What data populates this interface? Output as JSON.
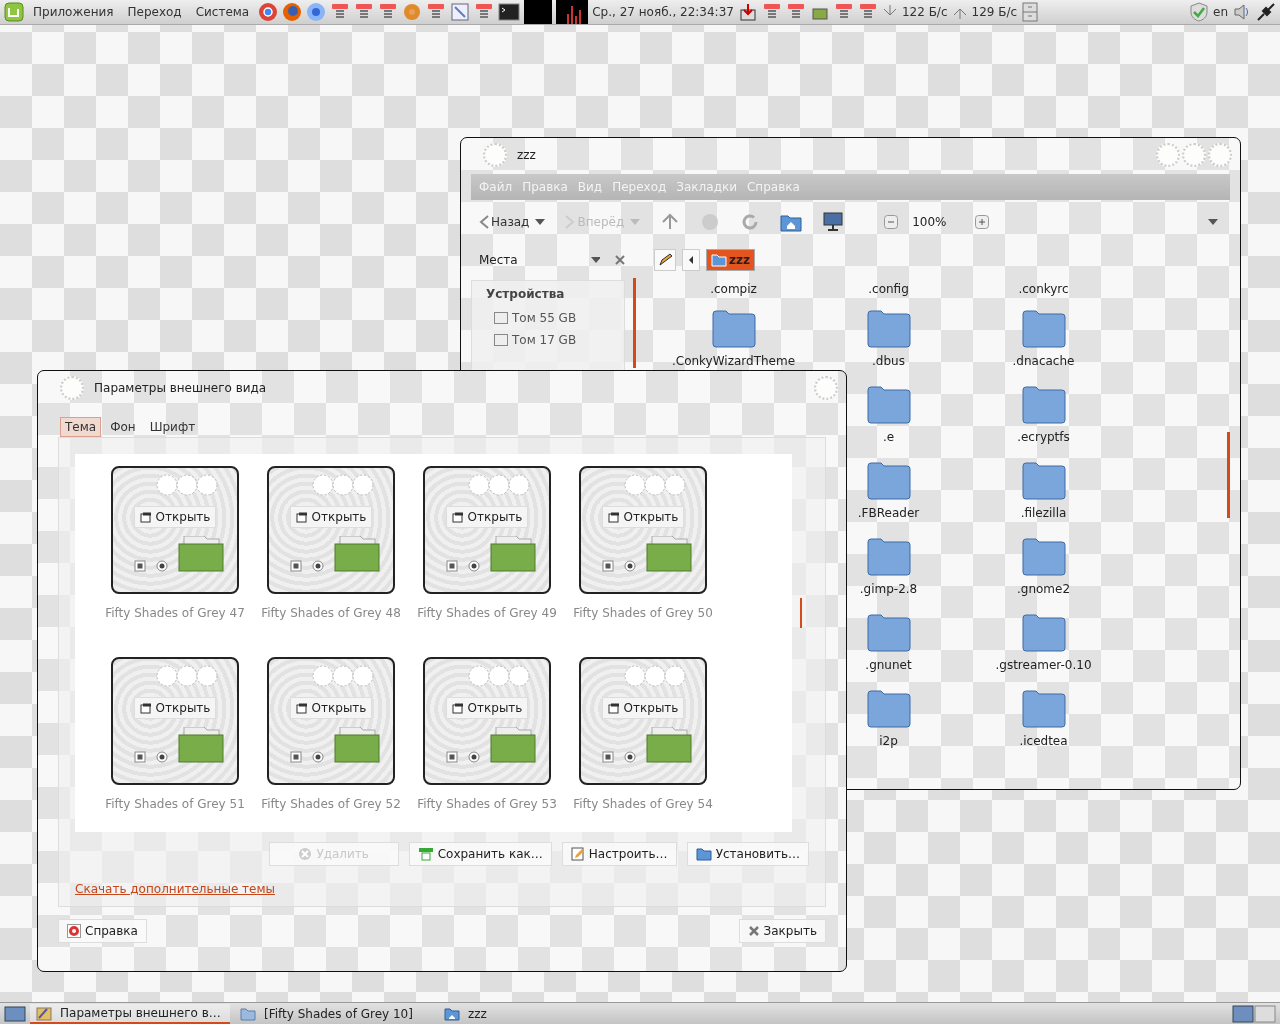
{
  "top_panel": {
    "menus": [
      "Приложения",
      "Переход",
      "Система"
    ],
    "clock": "Ср., 27 нояб., 22:34:37",
    "net_down": "122 Б/с",
    "net_up": "129 Б/с",
    "keyboard_layout": "en"
  },
  "file_manager": {
    "title": "zzz",
    "menu": [
      "Файл",
      "Правка",
      "Вид",
      "Переход",
      "Закладки",
      "Справка"
    ],
    "toolbar": {
      "back": "Назад",
      "forward": "Вперёд",
      "forward_disabled": true,
      "zoom": "100%"
    },
    "sidebar": {
      "selector": "Места",
      "header": "Устройства",
      "items": [
        "Том 55 GB",
        "Том 17 GB"
      ]
    },
    "path": [
      {
        "label": "zzz",
        "selected": true
      }
    ],
    "files": [
      {
        "name": ".compiz",
        "kind": "name_only"
      },
      {
        "name": ".config",
        "kind": "name_only"
      },
      {
        "name": ".conkyrc",
        "kind": "name_only"
      },
      {
        "name": ".ConkyWizardTheme",
        "kind": "folder"
      },
      {
        "name": ".dbus",
        "kind": "folder"
      },
      {
        "name": ".dnacache",
        "kind": "folder"
      }
    ],
    "files_right": [
      {
        "name": ".e"
      },
      {
        "name": ".ecryptfs"
      },
      {
        "name": ".FBReader"
      },
      {
        "name": ".filezilla"
      },
      {
        "name": ".gimp-2.8"
      },
      {
        "name": ".gnome2"
      },
      {
        "name": ".gnunet"
      },
      {
        "name": ".gstreamer-0.10"
      },
      {
        "name": "i2p"
      },
      {
        "name": ".icedtea"
      }
    ]
  },
  "appearance": {
    "title": "Параметры внешнего вида",
    "tabs": [
      {
        "label": "Тема",
        "selected": true
      },
      {
        "label": "Фон",
        "selected": false
      },
      {
        "label": "Шрифт",
        "selected": false
      }
    ],
    "themes": [
      {
        "name": "Fifty Shades of Grey 47",
        "preview_button": "Открыть"
      },
      {
        "name": "Fifty Shades of Grey 48",
        "preview_button": "Открыть"
      },
      {
        "name": "Fifty Shades of Grey 49",
        "preview_button": "Открыть"
      },
      {
        "name": "Fifty Shades of Grey 50",
        "preview_button": "Открыть"
      },
      {
        "name": "Fifty Shades of Grey 51",
        "preview_button": "Открыть"
      },
      {
        "name": "Fifty Shades of Grey 52",
        "preview_button": "Открыть"
      },
      {
        "name": "Fifty Shades of Grey 53",
        "preview_button": "Открыть"
      },
      {
        "name": "Fifty Shades of Grey 54",
        "preview_button": "Открыть"
      }
    ],
    "actions": [
      {
        "label": "Удалить",
        "kind": "delete",
        "disabled": true
      },
      {
        "label": "Сохранить как…",
        "kind": "save",
        "disabled": false
      },
      {
        "label": "Настроить…",
        "kind": "edit",
        "disabled": false
      },
      {
        "label": "Установить…",
        "kind": "install",
        "disabled": false
      }
    ],
    "link": "Скачать дополнительные темы",
    "help": "Справка",
    "close": "Закрыть"
  },
  "taskbar": [
    {
      "label": "Параметры внешнего в…",
      "kind": "app",
      "selected": true
    },
    {
      "label": "[Fifty Shades of Grey 10]",
      "kind": "folder",
      "selected": false
    },
    {
      "label": "zzz",
      "kind": "home",
      "selected": false
    }
  ]
}
